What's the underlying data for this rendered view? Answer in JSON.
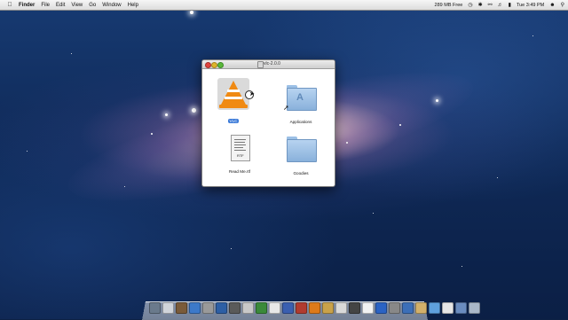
{
  "menubar": {
    "app_name": "Finder",
    "items": [
      "File",
      "Edit",
      "View",
      "Go",
      "Window",
      "Help"
    ],
    "memory": "289 MB Free",
    "clock": "Tue 3:49 PM"
  },
  "window": {
    "title": "vlc-2.0.0",
    "items": {
      "vlc": "VLC",
      "applications": "Applications",
      "readme": "Read Me.rtf",
      "readme_ext": "RTF",
      "goodies": "Goodies"
    }
  },
  "colors": {
    "selection": "#3b7ad8",
    "vlc_orange": "#f08a13",
    "folder_blue": "#89b1db"
  },
  "dock": {
    "icon_colors": [
      "#6a7a8c",
      "#d0d4da",
      "#7a5b3a",
      "#3c79c9",
      "#9a9a9a",
      "#2d5fa5",
      "#5a5a5a",
      "#c8c8c8",
      "#3a8a3a",
      "#e8e8e8",
      "#3a5fb0",
      "#b13b2f",
      "#dd7a1a",
      "#c9a24a",
      "#d9d9d9",
      "#444444",
      "#f2f2f2",
      "#2b63c4",
      "#888888",
      "#3c6fb8",
      "#d2b06a",
      "#5fa0dc",
      "#e6e6e6",
      "#6a8cbf",
      "#aab8c8"
    ]
  }
}
